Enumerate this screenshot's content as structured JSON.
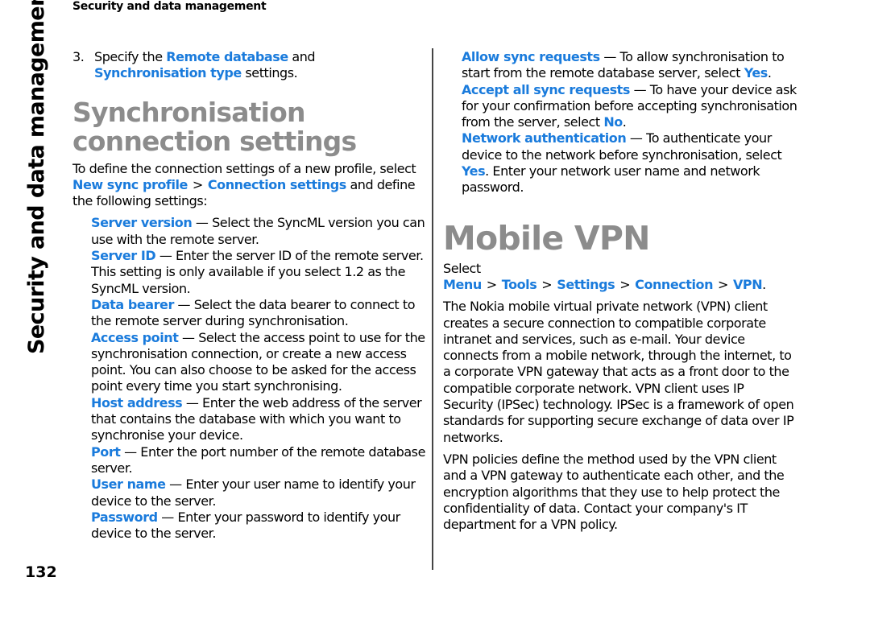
{
  "running_head": "Security and data management",
  "side_tab": "Security and data management",
  "page_number": "132",
  "left_column": {
    "step": {
      "number": "3.",
      "prefix": "Specify the ",
      "link1": "Remote database",
      "mid": " and ",
      "link2": "Synchronisation type",
      "suffix": " settings."
    },
    "heading": "Synchronisation connection settings",
    "intro": {
      "prefix": "To define the connection settings of a new profile, select ",
      "link1": "New sync profile",
      "sep": ">",
      "link2": "Connection settings",
      "suffix": " and define the following settings:"
    },
    "definitions": [
      {
        "term": "Server version",
        "text": " — Select the SyncML version you can use with the remote server."
      },
      {
        "term": "Server ID",
        "text": " — Enter the server ID of the remote server. This setting is only available if you select 1.2 as the SyncML version."
      },
      {
        "term": "Data bearer",
        "text": " — Select the data bearer to connect to the remote server during synchronisation."
      },
      {
        "term": "Access point",
        "text": " — Select the access point to use for the synchronisation connection, or create a new access point. You can also choose to be asked for the access point every time you start synchronising."
      },
      {
        "term": "Host address",
        "text": " — Enter the web address of the server that contains the database with which you want to synchronise your device."
      },
      {
        "term": "Port",
        "text": " — Enter the port number of the remote database server."
      },
      {
        "term": "User name",
        "text": " — Enter your user name to identify your device to the server."
      },
      {
        "term": "Password",
        "text": " — Enter your password to identify your device to the server."
      }
    ]
  },
  "right_column": {
    "definitions": [
      {
        "term": "Allow sync requests",
        "text": " — To allow synchronisation to start from the remote database server, select ",
        "value": "Yes",
        "after": "."
      },
      {
        "term": "Accept all sync requests",
        "text": " — To have your device ask for your confirmation before accepting synchronisation from the server, select ",
        "value": "No",
        "after": "."
      },
      {
        "term": "Network authentication",
        "text": " — To authenticate your device to the network before synchronisation, select ",
        "value": "Yes",
        "after": ". Enter your network user name and network password."
      }
    ],
    "heading": "Mobile VPN",
    "path": {
      "prefix": "Select ",
      "items": [
        "Menu",
        "Tools",
        "Settings",
        "Connection",
        "VPN"
      ],
      "sep": ">",
      "suffix": "."
    },
    "paragraphs": [
      "The Nokia mobile virtual private network (VPN) client creates a secure connection to compatible corporate intranet and services, such as e-mail. Your device connects from a mobile network, through the internet, to a corporate VPN gateway that acts as a front door to the compatible corporate network. VPN client uses IP Security (IPSec) technology. IPSec is a framework of open standards for supporting secure exchange of data over IP networks.",
      "VPN policies define the method used by the VPN client and a VPN gateway to authenticate each other, and the encryption algorithms that they use to help protect the confidentiality of data. Contact your company's IT department for a VPN policy."
    ]
  },
  "colors": {
    "link": "#1a7bdc",
    "heading": "#8c8c8c",
    "text": "#000000",
    "divider": "#444444"
  }
}
